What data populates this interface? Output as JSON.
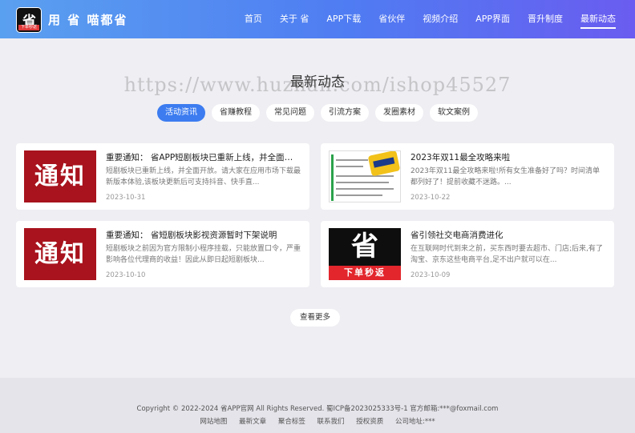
{
  "header": {
    "logo_char": "省",
    "logo_strip": "下单秒返",
    "brand": "用 省 喵都省",
    "nav": [
      "首页",
      "关于 省",
      "APP下载",
      "省伙伴",
      "视频介绍",
      "APP界面",
      "晋升制度",
      "最新动态"
    ],
    "active_nav_index": 7
  },
  "section": {
    "title": "最新动态",
    "watermark": "https://www.huzhan.com/ishop45527",
    "tabs": [
      "活动资讯",
      "省赚教程",
      "常见问题",
      "引流方案",
      "发圈素材",
      "软文案例"
    ],
    "active_tab_index": 0
  },
  "articles": [
    {
      "thumb": "notice",
      "thumb_text": "通知",
      "title": "重要通知： 省APP短剧板块已重新上线，并全面开放。请大家...",
      "desc": "短剧板块已重新上线，并全面开放。请大家在应用市场下载最新版本体验,该板块更新后可支持抖音、快手直...",
      "date": "2023-10-31"
    },
    {
      "thumb": "doc",
      "title": "2023年双11最全攻略来啦",
      "desc": "2023年双11最全攻略来啦!所有女生准备好了吗？时间清单都列好了！提前收藏不迷路。...",
      "date": "2023-10-22"
    },
    {
      "thumb": "notice",
      "thumb_text": "通知",
      "title": "重要通知： 省短剧板块影视资源暂时下架说明",
      "desc": "短剧板块之前因为官方限制小程序挂载，只能放置口令，严重影响各位代理商的收益！因此从即日起短剧板块...",
      "date": "2023-10-10"
    },
    {
      "thumb": "dark",
      "thumb_char": "省",
      "thumb_strip": "下单秒返",
      "title": "省引领社交电商消费进化",
      "desc": "在互联网时代到来之前，买东西时要去超市、门店;后来,有了淘宝、京东这些电商平台,足不出户就可以在...",
      "date": "2023-10-09"
    }
  ],
  "more_label": "查看更多",
  "footer": {
    "copyright": "Copyright © 2022-2024 省APP官网 All Rights Reserved. 蜀ICP备2023025333号-1 官方邮箱:***@foxmail.com",
    "links": [
      "网站地图",
      "最新文章",
      "聚合标签",
      "联系我们",
      "授权资质",
      "公司地址:***"
    ]
  },
  "colors": {
    "accent": "#3c7cf0",
    "header_gradient_start": "#5aa0f0",
    "header_gradient_end": "#6a5cf0",
    "notice_red": "#a8131d"
  }
}
